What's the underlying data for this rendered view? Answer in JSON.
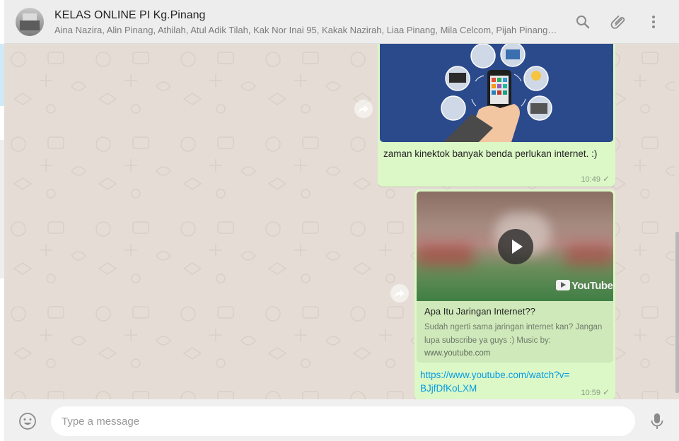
{
  "header": {
    "title": "KELAS ONLINE PI Kg.Pinang",
    "members": "Aina Nazira, Alin Pinang, Athilah, Atul Adik Tilah, Kak Nor Inai 95, Kakak Nazirah, Liaa Pinang, Mila Celcom, Pijah Pinang, Ti...",
    "icons": [
      "search-icon",
      "attach-icon",
      "menu-icon"
    ]
  },
  "messages": [
    {
      "type": "image",
      "caption": "zaman kinektok banyak benda perlukan internet. :)",
      "time": "10:49",
      "status": "✓"
    },
    {
      "type": "link",
      "preview_title": "Apa Itu Jaringan Internet??",
      "preview_description": "Sudah ngerti sama jaringan internet kan? Jangan lupa subscribe ya guys :) Music by:",
      "preview_domain": "www.youtube.com",
      "thumbnail_brand": "YouTube",
      "url": "https://www.youtube.com/watch?v=BJjfDfKoLXM",
      "time": "10:59",
      "status": "✓"
    }
  ],
  "composer": {
    "placeholder": "Type a message"
  },
  "colors": {
    "chat_background": "#e5ddd5",
    "outgoing_bubble": "#dcf8c6",
    "link": "#039be5",
    "header": "#ededed"
  }
}
